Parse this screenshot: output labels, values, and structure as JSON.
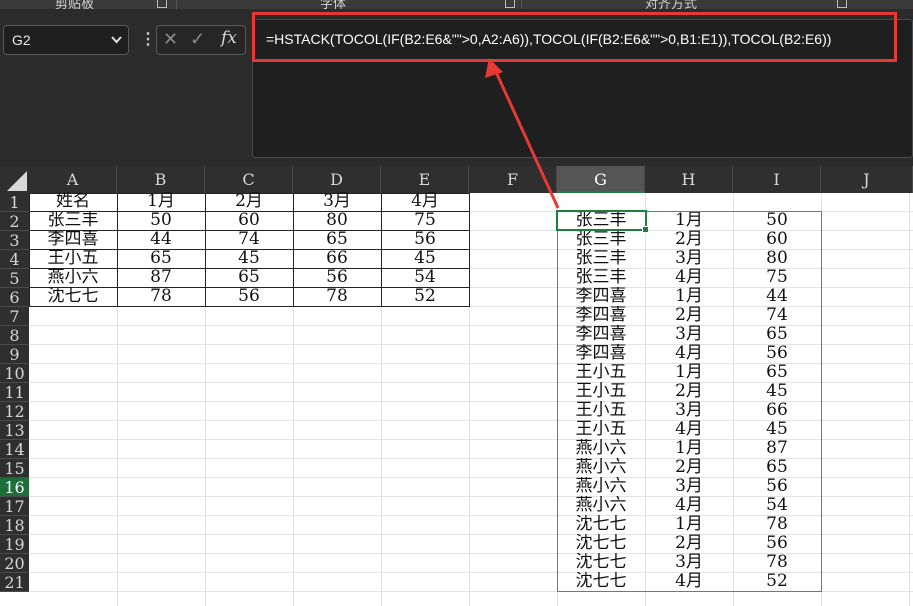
{
  "ribbon": {
    "groups": [
      "剪贴板",
      "字体",
      "对齐方式"
    ]
  },
  "namebox": {
    "value": "G2"
  },
  "formula_bar": {
    "formula": "=HSTACK(TOCOL(IF(B2:E6&\"\">0,A2:A6)),TOCOL(IF(B2:E6&\"\">0,B1:E1)),TOCOL(B2:E6))",
    "cancel_icon": "✕",
    "enter_icon": "✓",
    "fx_label": "fx"
  },
  "columns": [
    "A",
    "B",
    "C",
    "D",
    "E",
    "F",
    "G",
    "H",
    "I",
    "J"
  ],
  "rows": [
    "1",
    "2",
    "3",
    "4",
    "5",
    "6",
    "7",
    "8",
    "9",
    "10",
    "11",
    "12",
    "13",
    "14",
    "15",
    "16",
    "17",
    "18",
    "19",
    "20",
    "21"
  ],
  "source_table": {
    "header": [
      "姓名",
      "1月",
      "2月",
      "3月",
      "4月"
    ],
    "rows": [
      [
        "张三丰",
        "50",
        "60",
        "80",
        "75"
      ],
      [
        "李四喜",
        "44",
        "74",
        "65",
        "56"
      ],
      [
        "王小五",
        "65",
        "45",
        "66",
        "45"
      ],
      [
        "燕小六",
        "87",
        "65",
        "56",
        "54"
      ],
      [
        "沈七七",
        "78",
        "56",
        "78",
        "52"
      ]
    ]
  },
  "result_table": [
    [
      "张三丰",
      "1月",
      "50"
    ],
    [
      "张三丰",
      "2月",
      "60"
    ],
    [
      "张三丰",
      "3月",
      "80"
    ],
    [
      "张三丰",
      "4月",
      "75"
    ],
    [
      "李四喜",
      "1月",
      "44"
    ],
    [
      "李四喜",
      "2月",
      "74"
    ],
    [
      "李四喜",
      "3月",
      "65"
    ],
    [
      "李四喜",
      "4月",
      "56"
    ],
    [
      "王小五",
      "1月",
      "65"
    ],
    [
      "王小五",
      "2月",
      "45"
    ],
    [
      "王小五",
      "3月",
      "66"
    ],
    [
      "王小五",
      "4月",
      "45"
    ],
    [
      "燕小六",
      "1月",
      "87"
    ],
    [
      "燕小六",
      "2月",
      "65"
    ],
    [
      "燕小六",
      "3月",
      "56"
    ],
    [
      "燕小六",
      "4月",
      "54"
    ],
    [
      "沈七七",
      "1月",
      "78"
    ],
    [
      "沈七七",
      "2月",
      "56"
    ],
    [
      "沈七七",
      "3月",
      "78"
    ],
    [
      "沈七七",
      "4月",
      "52"
    ]
  ],
  "colors": {
    "highlight": "#e53935",
    "selection": "#1e7e3e",
    "spill_border": "#4a7fc1"
  },
  "selected_column": "G",
  "selected_row": "16"
}
